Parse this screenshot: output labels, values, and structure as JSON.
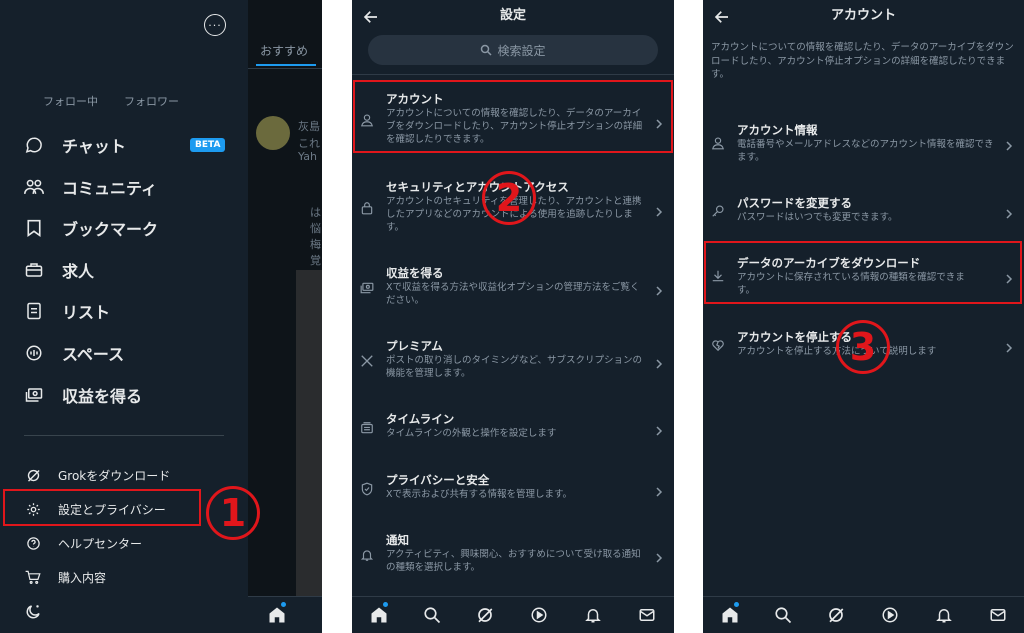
{
  "screen1": {
    "behind": {
      "tab": "おすすめ",
      "text1": "灰島",
      "text2": "これ",
      "text3": "Yah",
      "text4": "は",
      "text5": "悩",
      "text6": "梅",
      "text7": "覚"
    },
    "follow": {
      "following": "フォロー中",
      "followers": "フォロワー"
    },
    "nav": [
      {
        "label": "チャット",
        "icon": "chat-bubble-icon"
      },
      {
        "label": "コミュニティ",
        "icon": "community-icon"
      },
      {
        "label": "ブックマーク",
        "icon": "bookmark-icon"
      },
      {
        "label": "求人",
        "icon": "briefcase-icon"
      },
      {
        "label": "リスト",
        "icon": "list-icon"
      },
      {
        "label": "スペース",
        "icon": "spaces-icon"
      },
      {
        "label": "収益を得る",
        "icon": "money-icon"
      }
    ],
    "beta": "BETA",
    "sub": [
      {
        "label": "Grokをダウンロード",
        "icon": "grok-icon"
      },
      {
        "label": "設定とプライバシー",
        "icon": "gear-icon"
      },
      {
        "label": "ヘルプセンター",
        "icon": "help-icon"
      },
      {
        "label": "購入内容",
        "icon": "cart-icon"
      }
    ]
  },
  "screen2": {
    "title": "設定",
    "search_placeholder": "検索設定",
    "items": [
      {
        "title": "アカウント",
        "desc": "アカウントについての情報を確認したり、データのアーカイブをダウンロードしたり、アカウント停止オプションの詳細を確認したりできます。"
      },
      {
        "title": "セキュリティとアカウントアクセス",
        "desc": "アカウントのセキュリティを管理したり、アカウントと連携したアプリなどのアカウントによる使用を追跡したりします。"
      },
      {
        "title": "収益を得る",
        "desc": "Xで収益を得る方法や収益化オプションの管理方法をご覧ください。"
      },
      {
        "title": "プレミアム",
        "desc": "ポストの取り消しのタイミングなど、サブスクリプションの機能を管理します。"
      },
      {
        "title": "タイムライン",
        "desc": "タイムラインの外観と操作を設定します"
      },
      {
        "title": "プライバシーと安全",
        "desc": "Xで表示および共有する情報を管理します。"
      },
      {
        "title": "通知",
        "desc": "アクティビティ、興味関心、おすすめについて受け取る通知の種類を選択します。"
      }
    ]
  },
  "screen3": {
    "title": "アカウント",
    "intro": "アカウントについての情報を確認したり、データのアーカイブをダウンロードしたり、アカウント停止オプションの詳細を確認したりできます。",
    "items": [
      {
        "title": "アカウント情報",
        "desc": "電話番号やメールアドレスなどのアカウント情報を確認できます。"
      },
      {
        "title": "パスワードを変更する",
        "desc": "パスワードはいつでも変更できます。"
      },
      {
        "title": "データのアーカイブをダウンロード",
        "desc": "アカウントに保存されている情報の種類を確認できます。"
      },
      {
        "title": "アカウントを停止する",
        "desc": "アカウントを停止する方法について説明します"
      }
    ]
  },
  "steps": {
    "one": "1",
    "two": "2",
    "three": "3"
  },
  "colors": {
    "background": "#15202b",
    "accent": "#1d9bf0",
    "highlight": "#e0161b",
    "muted": "#8b98a5"
  }
}
